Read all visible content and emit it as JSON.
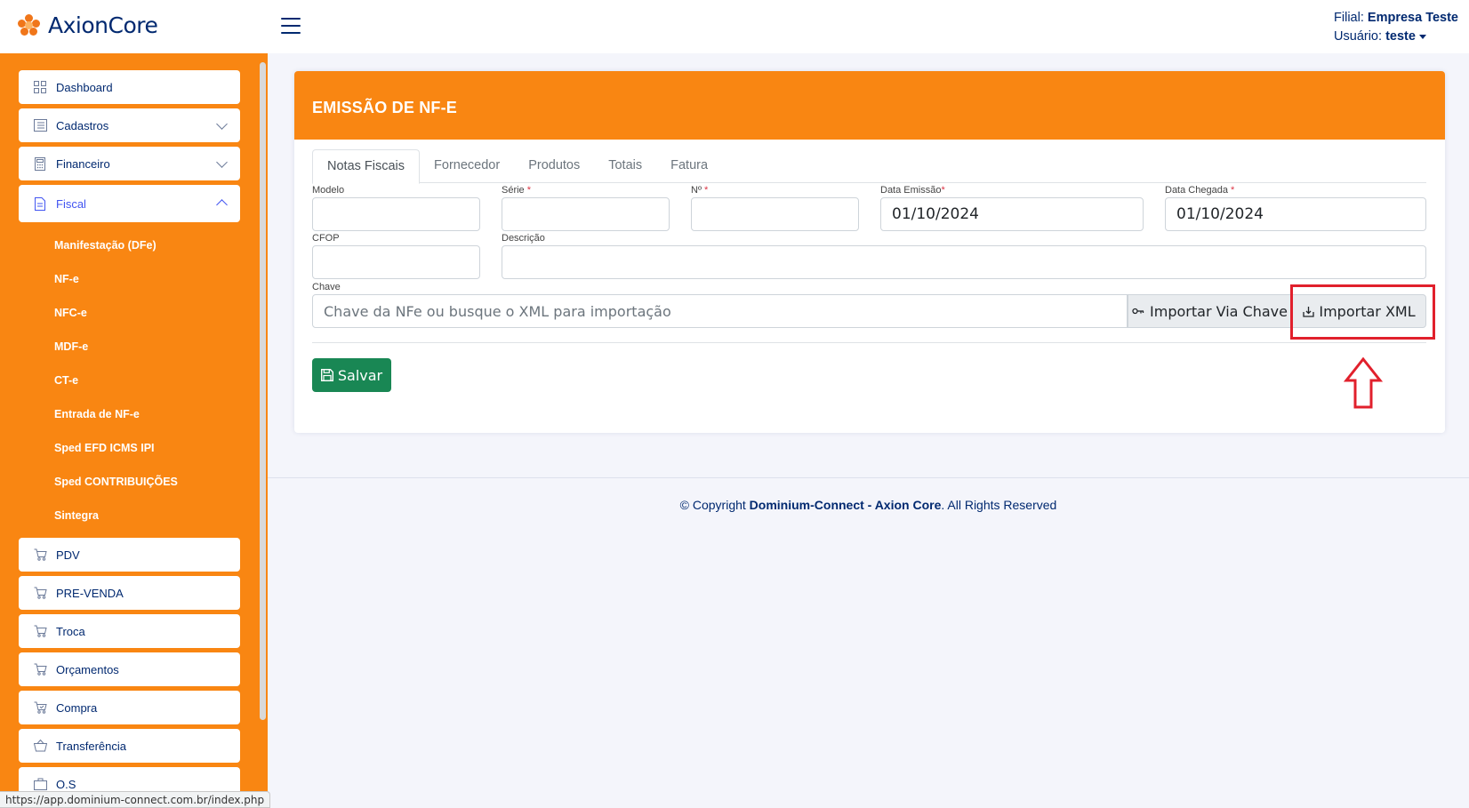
{
  "header": {
    "brand": "AxionCore",
    "filial_label": "Filial:",
    "filial_value": "Empresa Teste",
    "usuario_label": "Usuário:",
    "usuario_value": "teste"
  },
  "sidebar": {
    "items": [
      {
        "label": "Dashboard",
        "icon": "grid-icon"
      },
      {
        "label": "Cadastros",
        "icon": "list-icon"
      },
      {
        "label": "Financeiro",
        "icon": "calculator-icon"
      },
      {
        "label": "Fiscal",
        "icon": "document-icon"
      }
    ],
    "fiscal_sub": [
      "Manifestação (DFe)",
      "NF-e",
      "NFC-e",
      "MDF-e",
      "CT-e",
      "Entrada de NF-e",
      "Sped EFD ICMS IPI",
      "Sped CONTRIBUIÇÕES",
      "Sintegra"
    ],
    "bottom_items": [
      {
        "label": "PDV",
        "icon": "cart-icon"
      },
      {
        "label": "PRE-VENDA",
        "icon": "cart-icon"
      },
      {
        "label": "Troca",
        "icon": "cart-icon"
      },
      {
        "label": "Orçamentos",
        "icon": "cart-icon"
      },
      {
        "label": "Compra",
        "icon": "cart-check-icon"
      },
      {
        "label": "Transferência",
        "icon": "basket-icon"
      },
      {
        "label": "O.S",
        "icon": "briefcase-icon"
      }
    ]
  },
  "card": {
    "title": "EMISSÃO DE NF-E",
    "tabs": [
      "Notas Fiscais",
      "Fornecedor",
      "Produtos",
      "Totais",
      "Fatura"
    ],
    "fields": {
      "modelo_label": "Modelo",
      "serie_label": "Série",
      "numero_label": "Nº",
      "data_emissao_label": "Data Emissão",
      "data_emissao_value": "01/10/2024",
      "data_chegada_label": "Data Chegada",
      "data_chegada_value": "01/10/2024",
      "cfop_label": "CFOP",
      "descricao_label": "Descrição",
      "chave_label": "Chave",
      "chave_placeholder": "Chave da NFe ou busque o XML para importação",
      "required_mark": "*"
    },
    "btn_importar_chave": "Importar Via Chave",
    "btn_importar_xml": "Importar XML",
    "btn_salvar": "Salvar"
  },
  "footer": {
    "prefix": "© Copyright",
    "company": "Dominium-Connect - Axion Core",
    "suffix": ". All Rights Reserved"
  },
  "statusbar": "https://app.dominium-connect.com.br/index.php",
  "colors": {
    "accent": "#f98612",
    "brand_text": "#012970",
    "save_button": "#198754",
    "highlight": "#e1202c"
  }
}
